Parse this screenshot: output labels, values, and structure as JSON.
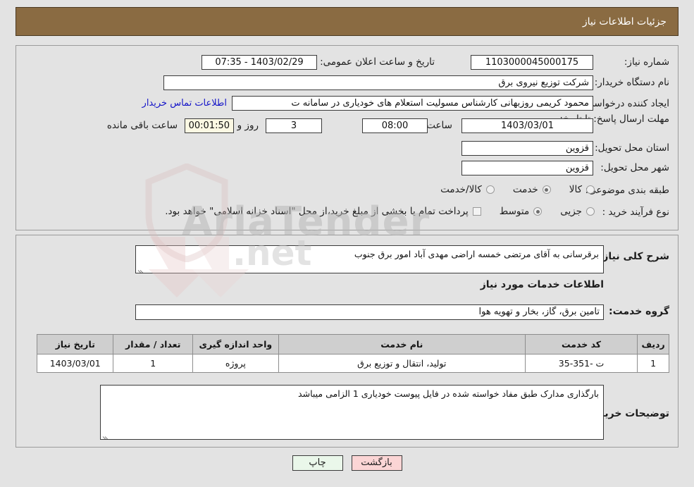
{
  "header": {
    "title": "جزئیات اطلاعات نیاز"
  },
  "fields": {
    "need_number": {
      "label": "شماره نیاز:",
      "value": "1103000045000175"
    },
    "public_announce": {
      "label": "تاریخ و ساعت اعلان عمومی:",
      "value": "1403/02/29 - 07:35"
    },
    "buyer_org": {
      "label": "نام دستگاه خریدار:",
      "value": "شرکت توزیع نیروی برق"
    },
    "creator": {
      "label": "ایجاد کننده درخواست:",
      "value": "محمود کریمی روزبهانی کارشناس  مسولیت استعلام های خودیاری در سامانه ت"
    },
    "buyer_contact_link": "اطلاعات تماس خریدار",
    "deadline": {
      "label": "مهلت ارسال پاسخ: تا تاریخ:",
      "value": "1403/03/01"
    },
    "deadline_time": {
      "label": "ساعت",
      "value": "08:00"
    },
    "remaining_days": {
      "label": "روز و",
      "value": "3"
    },
    "remaining_time": {
      "label": "ساعت باقی مانده",
      "value": "00:01:50"
    },
    "province": {
      "label": "استان محل تحویل:",
      "value": "قزوین"
    },
    "city": {
      "label": "شهر محل تحویل:",
      "value": "قزوین"
    }
  },
  "classification": {
    "label": "طبقه بندی موضوعی:",
    "options": [
      {
        "label": "کالا",
        "selected": false
      },
      {
        "label": "خدمت",
        "selected": true
      },
      {
        "label": "کالا/خدمت",
        "selected": false
      }
    ]
  },
  "purchase_process": {
    "label": "نوع فرآیند خرید :",
    "options": [
      {
        "label": "جزیی",
        "selected": false
      },
      {
        "label": "متوسط",
        "selected": true
      }
    ],
    "checkbox": {
      "label": "پرداخت تمام یا بخشی از مبلغ خرید،از محل \"اسناد خزانه اسلامی\" خواهد بود.",
      "checked": false
    }
  },
  "description": {
    "label": "شرح کلی نیاز:",
    "value": "برقرسانی به آقای مرتضی خمسه اراضی مهدی آباد امور برق جنوب"
  },
  "services_section": {
    "heading": "اطلاعات خدمات مورد نیاز",
    "group_label": "گروه خدمت:",
    "group_value": "تامین برق، گاز، بخار و تهویه هوا"
  },
  "table": {
    "headers": [
      "ردیف",
      "کد خدمت",
      "نام خدمت",
      "واحد اندازه گیری",
      "تعداد / مقدار",
      "تاریخ نیاز"
    ],
    "rows": [
      [
        "1",
        "ت -351-35",
        "تولید، انتقال و توزیع برق",
        "پروژه",
        "1",
        "1403/03/01"
      ]
    ]
  },
  "buyer_notes": {
    "label": "توضیحات خریدار:",
    "value": "بارگذاری مدارک طبق مفاد خواسته شده در فایل پیوست خودیاری 1 الزامی میباشد"
  },
  "buttons": {
    "print": "چاپ",
    "back": "بازگشت"
  },
  "watermark": {
    "text": "AriaTender",
    "suffix": ".net"
  },
  "colors": {
    "header_bg": "#8a6b42",
    "page_bg": "#e3e3e3",
    "link": "#1414c8",
    "print_btn": "#eaf7ea",
    "back_btn": "#fbd5d5",
    "cream_field": "#fbf8e3"
  }
}
